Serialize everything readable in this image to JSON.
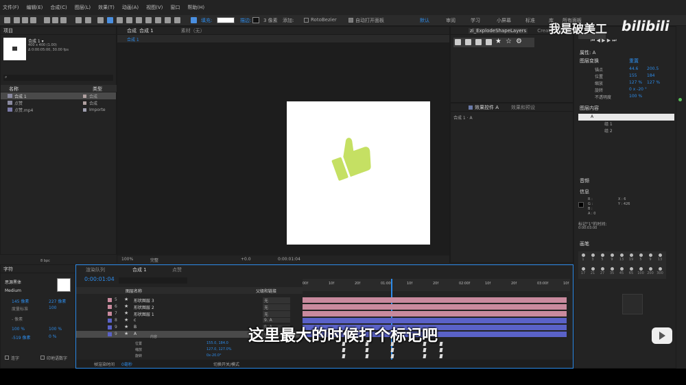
{
  "menu": [
    "文件(F)",
    "编辑(E)",
    "合成(C)",
    "图层(L)",
    "效果(T)",
    "动画(A)",
    "视图(V)",
    "窗口",
    "帮助(H)"
  ],
  "toolbar": {
    "fill_label": "填充:",
    "stroke_label": "描边:",
    "stroke_width": "3 像素",
    "add_label": "添加:",
    "rotobezier": "RotoBezier",
    "auto_open": "自动打开面板",
    "workspaces": [
      "默认",
      "审阅",
      "学习",
      "小屏幕",
      "标准",
      "库",
      "所有面板"
    ]
  },
  "project": {
    "title": "项目",
    "comp_name": "合成 1 ▾",
    "comp_size": "400 x 400 (1.00)",
    "comp_dur": "Δ 0:00:05:00, 30.00 fps",
    "search_placeholder": "",
    "col_name": "名称",
    "col_type": "类型",
    "items": [
      {
        "name": "合成 1",
        "type": "合成"
      },
      {
        "name": "点赞",
        "type": "合成"
      },
      {
        "name": "点赞.mp4",
        "type": "Importe"
      }
    ],
    "bpc": "8 bpc"
  },
  "viewer": {
    "tab_comp": "合成",
    "tab_comp_name": "合成 1",
    "tab_footage": "素材（无）",
    "breadcrumb": "合成 1",
    "zoom": "100%",
    "quality": "完整",
    "exposure": "+0.0",
    "timecode": "0:00:01:04"
  },
  "explode": {
    "title": "zi_ExplodeShapeLayers",
    "create_nulls": "Create Nulls Fr"
  },
  "effects": {
    "tab": "效果控件 A",
    "tab2": "效果和预设",
    "sub": "合成 1 · A"
  },
  "properties": {
    "title": "属性: A",
    "group": "图层变换",
    "reset": "重置",
    "rows": [
      {
        "label": "锚点",
        "v1": "44.6",
        "v2": "200.5"
      },
      {
        "label": "位置",
        "v1": "155",
        "v2": "184"
      },
      {
        "label": "缩放",
        "v1": "127 %",
        "v2": "127 %"
      },
      {
        "label": "旋转",
        "v1": "0 x -20 °",
        "v2": ""
      },
      {
        "label": "不透明度",
        "v1": "100 %",
        "v2": ""
      }
    ],
    "contents_title": "图层内容",
    "contents": [
      "A",
      "组 1",
      "组 2"
    ]
  },
  "audio": {
    "title": "音频"
  },
  "info": {
    "title": "信息",
    "r": "R :",
    "g": "G :",
    "b": "B :",
    "a": "A : 0",
    "x": "X : 6",
    "y": "Y : 426",
    "marker": "标记\"1\"的时间:",
    "marker_time": "0:00:03:00"
  },
  "brush": {
    "title": "画笔",
    "sizes": [
      "1",
      "3",
      "5",
      "9",
      "13",
      "19",
      "5",
      "9",
      "13",
      "17",
      "21",
      "27",
      "35",
      "45",
      "65",
      "100",
      "200",
      "300"
    ]
  },
  "character": {
    "title": "字符",
    "font": "思源黑体",
    "style": "Medium",
    "size": "145 像素",
    "leading": "227 像素",
    "kerning": "度量标准",
    "tracking": "100",
    "stroke": "- 像素",
    "vscale": "100 %",
    "hscale": "100 %",
    "baseline": "-519 像素",
    "tsume": "0 %",
    "ligature": "连字",
    "hindi": "印地语数字"
  },
  "timeline": {
    "tab_render": "渲染队列",
    "tab_comp": "合成 1",
    "tab_like": "点赞",
    "timecode": "0:00:01:04",
    "col_layer": "图层名称",
    "col_parent": "父级和链接",
    "ruler": [
      "00f",
      "10f",
      "20f",
      "01:00f",
      "10f",
      "20f",
      "02:00f",
      "10f",
      "20f",
      "03:00f",
      "10f"
    ],
    "layers": [
      {
        "num": "5",
        "name": "形状图层 3",
        "parent": "无",
        "color": "#c98a9e"
      },
      {
        "num": "6",
        "name": "形状图层 2",
        "parent": "无",
        "color": "#c98a9e"
      },
      {
        "num": "7",
        "name": "形状图层 1",
        "parent": "无",
        "color": "#c98a9e"
      },
      {
        "num": "8",
        "name": "c",
        "parent": "9. A",
        "color": "#5a62c8"
      },
      {
        "num": "9",
        "name": "B",
        "parent": "9. A",
        "color": "#5a62c8"
      },
      {
        "num": "9",
        "name": "A",
        "parent": "无",
        "color": "#5a62c8"
      }
    ],
    "contents_label": "内容",
    "props": [
      {
        "name": "位置",
        "value": "155.0, 184.0"
      },
      {
        "name": "缩放",
        "value": "127.0, 127.0%"
      },
      {
        "name": "旋转",
        "value": "0x-20.0°"
      }
    ],
    "footer_render": "帧渲染时间",
    "footer_ms": "0毫秒",
    "footer_toggle": "切换开关/模式"
  },
  "overlay": {
    "watermark": "我是破美工",
    "bilibili": "bilibili",
    "subtitle": "这里最大的时候打个标记吧"
  },
  "colors": {
    "accent": "#2d8ceb",
    "thumb": "#c5e063",
    "subtitle": "#ffffff"
  }
}
